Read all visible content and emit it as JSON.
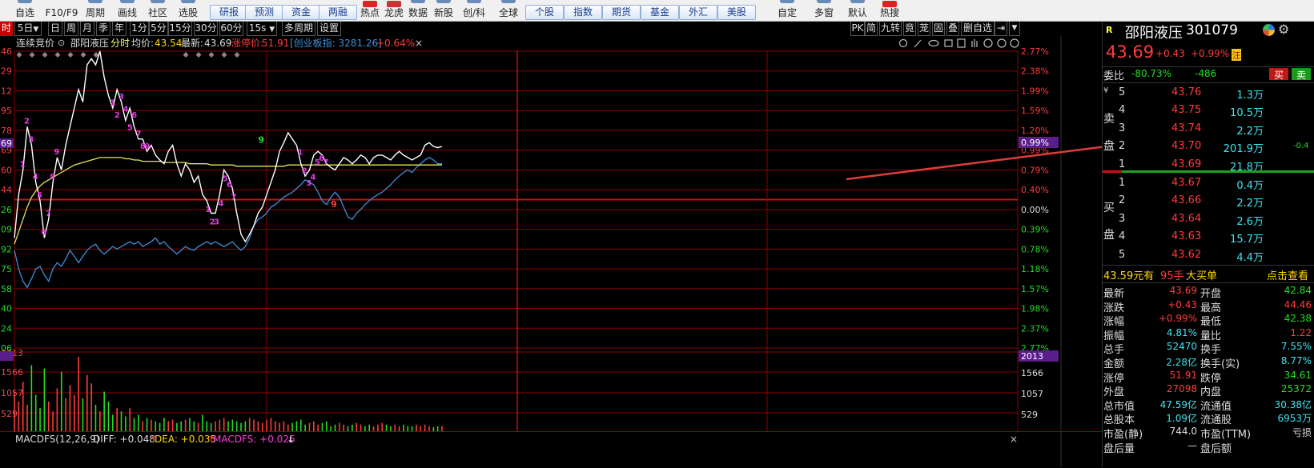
{
  "toolbar": {
    "left_items": [
      "自选",
      "F10/F9",
      "周期",
      "画线",
      "社区",
      "选股"
    ],
    "buttons": [
      "研报",
      "预测",
      "资金",
      "两融"
    ],
    "mid_items": [
      "热点",
      "龙虎",
      "数据",
      "新股",
      "创/科"
    ],
    "global_label": "全球",
    "buttons2": [
      "个股",
      "指数",
      "期货",
      "基金",
      "外汇",
      "美股"
    ],
    "right_items": [
      "自定",
      "多窗",
      "默认",
      "热搜"
    ]
  },
  "period_bar": {
    "first": "时",
    "items": [
      "5日",
      "日",
      "周",
      "月",
      "季",
      "年",
      "1分",
      "5分",
      "15分",
      "30分",
      "60分",
      "15s",
      "多周期",
      "设置"
    ],
    "right_items": [
      "PK",
      "简",
      "九转",
      "竟",
      "茏",
      "固",
      "叠",
      "删自选"
    ]
  },
  "chart_header": {
    "auction": "连续竞价",
    "name": "邵阳液压",
    "mode": "分时",
    "avg_label": "均价:",
    "avg_value": "43.54",
    "latest_label": "最新:",
    "latest_value": "43.69",
    "limit_label": "涨停价:",
    "limit_value": "51.91",
    "index_text": "[创业板指: 3281.26]",
    "change_pct": "+0.64%",
    "close": "×"
  },
  "chart_data": {
    "type": "line",
    "price_axis": [
      "46",
      "29",
      "12",
      "95",
      "78",
      "69",
      "60",
      "44",
      "26",
      "09",
      "92",
      "75",
      "58",
      "40",
      "24",
      "06"
    ],
    "price_axis_current": "69",
    "pct_axis": [
      "2.77%",
      "2.38%",
      "1.99%",
      "1.59%",
      "1.20%",
      "0.99%",
      "0.79%",
      "0.40%",
      "0.00%",
      "0.39%",
      "0.78%",
      "1.18%",
      "1.57%",
      "1.98%",
      "2.37%",
      "2.77%"
    ],
    "pct_axis_current": "0.99%",
    "volume_axis": [
      "2013",
      "1566",
      "1057",
      "529"
    ],
    "prev_close": 43.26,
    "price_min": 42.06,
    "price_max": 44.46,
    "price_series": [
      42.95,
      43.3,
      43.5,
      43.85,
      43.7,
      43.4,
      43.25,
      42.95,
      43.1,
      43.4,
      43.6,
      43.5,
      43.7,
      43.85,
      44.0,
      44.15,
      44.05,
      44.35,
      44.4,
      44.35,
      44.46,
      44.25,
      44.1,
      44.0,
      44.15,
      44.05,
      43.9,
      44.0,
      43.85,
      43.75,
      43.75,
      43.65,
      43.7,
      43.62,
      43.58,
      43.55,
      43.65,
      43.7,
      43.55,
      43.45,
      43.55,
      43.5,
      43.4,
      43.45,
      43.3,
      43.25,
      43.15,
      43.15,
      43.3,
      43.5,
      43.45,
      43.35,
      43.15,
      42.98,
      42.92,
      42.98,
      43.05,
      43.15,
      43.2,
      43.3,
      43.4,
      43.5,
      43.65,
      43.72,
      43.8,
      43.75,
      43.7,
      43.55,
      43.45,
      43.5,
      43.62,
      43.65,
      43.62,
      43.55,
      43.52,
      43.5,
      43.55,
      43.6,
      43.58,
      43.55,
      43.58,
      43.62,
      43.6,
      43.55,
      43.6,
      43.62,
      43.62,
      43.6,
      43.58,
      43.62,
      43.65,
      43.62,
      43.6,
      43.58,
      43.6,
      43.62,
      43.7,
      43.72,
      43.69,
      43.68,
      43.69
    ],
    "avg_series": [
      42.9,
      43.0,
      43.1,
      43.2,
      43.28,
      43.33,
      43.37,
      43.4,
      43.42,
      43.44,
      43.46,
      43.48,
      43.5,
      43.52,
      43.54,
      43.55,
      43.56,
      43.57,
      43.58,
      43.59,
      43.6,
      43.6,
      43.6,
      43.6,
      43.6,
      43.6,
      43.59,
      43.59,
      43.58,
      43.58,
      43.57,
      43.57,
      43.57,
      43.57,
      43.57,
      43.56,
      43.56,
      43.56,
      43.56,
      43.56,
      43.56,
      43.55,
      43.55,
      43.55,
      43.55,
      43.55,
      43.54,
      43.54,
      43.54,
      43.54,
      43.54,
      43.54,
      43.53,
      43.53,
      43.53,
      43.53,
      43.53,
      43.53,
      43.53,
      43.53,
      43.53,
      43.53,
      43.53,
      43.53,
      43.54,
      43.54,
      43.54,
      43.54,
      43.54,
      43.54,
      43.54,
      43.54,
      43.54,
      43.54,
      43.54,
      43.54,
      43.54,
      43.54,
      43.54,
      43.54,
      43.54,
      43.54,
      43.54,
      43.54,
      43.54,
      43.54,
      43.54,
      43.54,
      43.54,
      43.54,
      43.54,
      43.54,
      43.54,
      43.54,
      43.54,
      43.54,
      43.54,
      43.54,
      43.54,
      43.54,
      43.54
    ],
    "index_series": [
      42.85,
      42.7,
      42.6,
      42.55,
      42.62,
      42.7,
      42.72,
      42.65,
      42.6,
      42.7,
      42.75,
      42.72,
      42.78,
      42.85,
      42.8,
      42.75,
      42.8,
      42.85,
      42.88,
      42.9,
      42.85,
      42.82,
      42.85,
      42.88,
      42.86,
      42.88,
      42.9,
      42.92,
      42.9,
      42.92,
      42.88,
      42.9,
      42.92,
      42.95,
      42.9,
      42.92,
      42.88,
      42.85,
      42.82,
      42.85,
      42.88,
      42.86,
      42.85,
      42.88,
      42.9,
      42.92,
      42.9,
      42.92,
      42.9,
      42.88,
      42.9,
      42.92,
      42.88,
      42.85,
      42.88,
      42.95,
      43.05,
      43.1,
      43.12,
      43.15,
      43.2,
      43.22,
      43.25,
      43.28,
      43.3,
      43.32,
      43.35,
      43.38,
      43.42,
      43.4,
      43.38,
      43.32,
      43.25,
      43.22,
      43.28,
      43.32,
      43.28,
      43.2,
      43.12,
      43.1,
      43.15,
      43.18,
      43.22,
      43.25,
      43.28,
      43.3,
      43.32,
      43.35,
      43.38,
      43.42,
      43.45,
      43.48,
      43.5,
      43.48,
      43.52,
      43.55,
      43.58,
      43.6,
      43.58,
      43.55,
      43.55
    ],
    "volume_values": [
      1200,
      900,
      1500,
      800,
      2000,
      1100,
      700,
      1900,
      900,
      600,
      1300,
      1800,
      1000,
      1400,
      1100,
      2250,
      1000,
      1700,
      1450,
      800,
      600,
      1200,
      900,
      500,
      700,
      600,
      450,
      700,
      400,
      500,
      300,
      400,
      350,
      300,
      250,
      400,
      300,
      350,
      250,
      300,
      350,
      400,
      300,
      250,
      500,
      300,
      250,
      300,
      350,
      400,
      300,
      350,
      300,
      250,
      300,
      400,
      350,
      300,
      250,
      350,
      400,
      300,
      250,
      300,
      200,
      250,
      300,
      350,
      200,
      250,
      300,
      200,
      250,
      300,
      150,
      200,
      250,
      200,
      150,
      200,
      250,
      200,
      150,
      200,
      150,
      200,
      250,
      200,
      150,
      200,
      150,
      200,
      150,
      150,
      200,
      150,
      200,
      150,
      120,
      150,
      150
    ]
  },
  "sequence_labels": {
    "up": [
      "1",
      "2",
      "3",
      "4",
      "5",
      "6",
      "7",
      "8",
      "9"
    ],
    "down": [
      "1",
      "2",
      "3",
      "4",
      "5",
      "6",
      "7",
      "8",
      "9"
    ],
    "green_nine": "9",
    "red_nine": "9"
  },
  "indicator": {
    "label": "MACDFS(12,26,9)",
    "diff": "DIFF: +0.048",
    "dea": "DEA: +0.035",
    "macdfs": "MACDFS: +0.026"
  },
  "stock": {
    "badge": "R",
    "name": "邵阳液压",
    "code": "301079",
    "price": "43.69",
    "change": "+0.43",
    "change_pct": "+0.99%",
    "tag": "汪",
    "weibi_label": "委比",
    "weibi_pct": "-80.73%",
    "weibi_diff": "-486",
    "buy_btn": "买",
    "sell_btn": "卖"
  },
  "order_book": {
    "sell_label": "卖盘",
    "buy_label": "买盘",
    "yen": "¥",
    "sells": [
      {
        "lvl": "5",
        "price": "43.76",
        "vol": "1.3万"
      },
      {
        "lvl": "4",
        "price": "43.75",
        "vol": "10.5万"
      },
      {
        "lvl": "3",
        "price": "43.74",
        "vol": "2.2万"
      },
      {
        "lvl": "2",
        "price": "43.70",
        "vol": "201.9万",
        "extra": "-0.4"
      },
      {
        "lvl": "1",
        "price": "43.69",
        "vol": "21.8万"
      }
    ],
    "buys": [
      {
        "lvl": "1",
        "price": "43.67",
        "vol": "0.4万"
      },
      {
        "lvl": "2",
        "price": "43.66",
        "vol": "2.2万"
      },
      {
        "lvl": "3",
        "price": "43.64",
        "vol": "2.6万"
      },
      {
        "lvl": "4",
        "price": "43.63",
        "vol": "15.7万"
      },
      {
        "lvl": "5",
        "price": "43.62",
        "vol": "4.4万"
      }
    ]
  },
  "big_order": {
    "price": "43.59元有",
    "hands": "95手",
    "label": "大买单",
    "link": "点击查看"
  },
  "stats": [
    {
      "k1": "最新",
      "v1": "43.69",
      "c1": "red",
      "k2": "开盘",
      "v2": "42.84",
      "c2": "green"
    },
    {
      "k1": "涨跌",
      "v1": "+0.43",
      "c1": "red",
      "k2": "最高",
      "v2": "44.46",
      "c2": "red"
    },
    {
      "k1": "涨幅",
      "v1": "+0.99%",
      "c1": "red",
      "k2": "最低",
      "v2": "42.38",
      "c2": "green"
    },
    {
      "k1": "振幅",
      "v1": "4.81%",
      "c1": "cyan",
      "k2": "量比",
      "v2": "1.22",
      "c2": "red"
    },
    {
      "k1": "总手",
      "v1": "52470",
      "c1": "cyan",
      "k2": "换手",
      "v2": "7.55%",
      "c2": "cyan"
    },
    {
      "k1": "金额",
      "v1": "2.28亿",
      "c1": "cyan",
      "k2": "换手(实)",
      "v2": "8.77%",
      "c2": "cyan"
    },
    {
      "k1": "涨停",
      "v1": "51.91",
      "c1": "red",
      "k2": "跌停",
      "v2": "34.61",
      "c2": "green"
    },
    {
      "k1": "外盘",
      "v1": "27098",
      "c1": "red",
      "k2": "内盘",
      "v2": "25372",
      "c2": "green"
    },
    {
      "k1": "总市值",
      "v1": "47.59亿",
      "c1": "cyan",
      "k2": "流通值",
      "v2": "30.38亿",
      "c2": "cyan"
    },
    {
      "k1": "总股本",
      "v1": "1.09亿",
      "c1": "cyan",
      "k2": "流通股",
      "v2": "6953万",
      "c2": "cyan"
    },
    {
      "k1": "市盈(静)",
      "v1": "744.0",
      "c1": "white",
      "k2": "市盈(TTM)",
      "v2": "亏损",
      "c2": "white"
    },
    {
      "k1": "盘后量",
      "v1": "—",
      "c1": "white",
      "k2": "盘后额",
      "v2": "",
      "c2": "white"
    }
  ],
  "colors": {
    "up": "#ff3b3b",
    "down": "#22dd22",
    "price_line": "#ffffff",
    "avg_line": "#e6e65a",
    "index_line": "#3d8fd8",
    "arrow": "#e03c3c",
    "grid": "#8b0000"
  }
}
